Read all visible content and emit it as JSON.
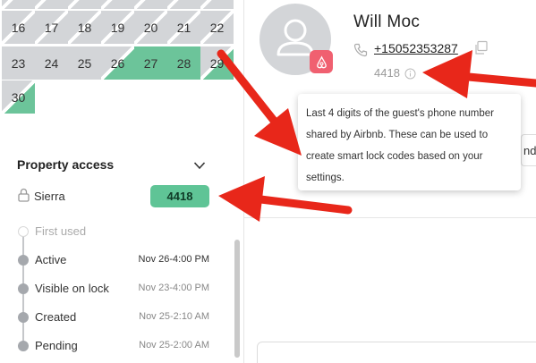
{
  "calendar": {
    "days": [
      {
        "label": "16",
        "style": "hatch"
      },
      {
        "label": "17",
        "style": "hatch"
      },
      {
        "label": "18",
        "style": "hatch"
      },
      {
        "label": "19",
        "style": "hatch"
      },
      {
        "label": "20",
        "style": "hatch"
      },
      {
        "label": "21",
        "style": "hatch"
      },
      {
        "label": "22",
        "style": "hatch"
      },
      {
        "label": "23",
        "style": "g"
      },
      {
        "label": "24",
        "style": "g"
      },
      {
        "label": "25",
        "style": "g"
      },
      {
        "label": "26",
        "style": "hatch2"
      },
      {
        "label": "27",
        "style": "gr"
      },
      {
        "label": "28",
        "style": "gr"
      },
      {
        "label": "29",
        "style": "hatch2"
      },
      {
        "label": "30",
        "style": "hatch2"
      }
    ]
  },
  "property_access": {
    "title": "Property access",
    "lock_name": "Sierra",
    "code": "4418",
    "timeline": [
      {
        "label": "First used",
        "time": "",
        "state": "empty"
      },
      {
        "label": "Active",
        "time": "Nov 26-4:00 PM",
        "state": "active"
      },
      {
        "label": "Visible on lock",
        "time": "Nov 23-4:00 PM",
        "state": "done"
      },
      {
        "label": "Created",
        "time": "Nov 25-2:10 AM",
        "state": "done"
      },
      {
        "label": "Pending",
        "time": "Nov 25-2:00 AM",
        "state": "done"
      }
    ]
  },
  "guest": {
    "name": "Will  Moc",
    "phone": "+15052353287",
    "last4": "4418"
  },
  "tooltip": {
    "text": "Last 4 digits of the guest's phone number shared by Airbnb. These can be used to create smart lock codes based on your settings."
  },
  "tab_sliver": "nd",
  "colors": {
    "accent_green": "#5fc496",
    "airbnb": "#f06070",
    "annotation_red": "#e8271a",
    "calendar_grey": "#d3d5d8"
  },
  "icons": [
    "lock-icon",
    "chevron-down-icon",
    "phone-icon",
    "copy-icon",
    "info-icon",
    "airbnb-icon",
    "avatar-icon"
  ]
}
